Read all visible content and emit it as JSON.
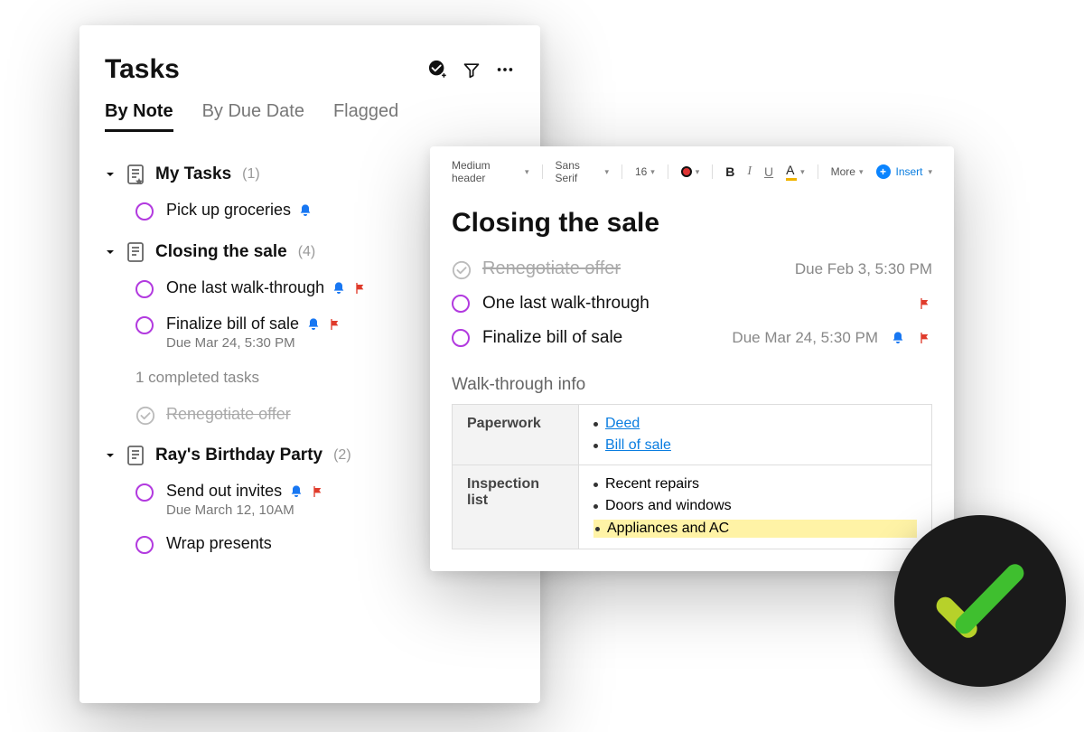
{
  "left": {
    "title": "Tasks",
    "tabs": {
      "by_note": "By Note",
      "by_due": "By Due Date",
      "flagged": "Flagged"
    },
    "groups": [
      {
        "name": "My Tasks",
        "count": "(1)",
        "tasks": [
          {
            "label": "Pick up groceries",
            "bell": true,
            "flag": false
          }
        ]
      },
      {
        "name": "Closing the sale",
        "count": "(4)",
        "tasks": [
          {
            "label": "One last walk-through",
            "bell": true,
            "flag": true
          },
          {
            "label": "Finalize bill of sale",
            "bell": true,
            "flag": true,
            "due": "Due Mar 24, 5:30 PM"
          }
        ],
        "completed_note": "1 completed tasks",
        "done": [
          {
            "label": "Renegotiate offer"
          }
        ]
      },
      {
        "name": "Ray's Birthday Party",
        "count": "(2)",
        "tasks": [
          {
            "label": "Send out invites",
            "bell": true,
            "flag": true,
            "due": "Due March 12, 10AM"
          },
          {
            "label": "Wrap presents"
          }
        ]
      }
    ]
  },
  "right": {
    "toolbar": {
      "heading": "Medium header",
      "font": "Sans Serif",
      "size": "16",
      "more": "More",
      "insert": "Insert"
    },
    "title": "Closing the sale",
    "tasks": [
      {
        "done": true,
        "label": "Renegotiate offer",
        "due": "Due Feb 3, 5:30 PM"
      },
      {
        "done": false,
        "label": "One last walk-through",
        "flag": true
      },
      {
        "done": false,
        "label": "Finalize bill of sale",
        "due": "Due Mar 24, 5:30 PM",
        "bell": true,
        "flag": true
      }
    ],
    "section": "Walk-through info",
    "table": {
      "row1": {
        "header": "Paperwork",
        "items": [
          "Deed",
          "Bill of sale"
        ]
      },
      "row2": {
        "header": "Inspection list",
        "items": [
          "Recent repairs",
          "Doors and windows",
          "Appliances and AC"
        ]
      }
    }
  }
}
